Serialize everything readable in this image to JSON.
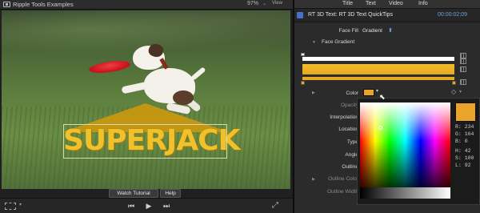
{
  "viewer": {
    "title": "Ripple Tools Examples",
    "zoom": "97%",
    "zoom_caret": "⌄",
    "view_menu": "View",
    "overlay_text": "SUPERJACK",
    "watch_tutorial": "Watch Tutorial",
    "help": "Help",
    "transport": {
      "prev": "⏮",
      "play": "▶",
      "next": "⏭"
    },
    "fullscreen": "⤢",
    "fit_caret": "▾"
  },
  "inspector": {
    "tabs": [
      "Title",
      "Text",
      "Video",
      "Info"
    ],
    "generator_title": "RT 3D Text: RT 3D Text QuickTips",
    "timecode": "00:00:02;09",
    "face_fill_label": "Face Fill",
    "face_fill_value": "Gradient",
    "face_fill_caret": "⬍",
    "face_gradient_label": "Face Gradient",
    "color_label": "Color",
    "opacity_label": "Opacity",
    "interpolation_label": "Interpolation",
    "location_label": "Location",
    "type_label": "Type",
    "angle_label": "Angle",
    "outline_label": "Outline",
    "outline_color_label": "Outline Color",
    "outline_width_label": "Outline Width",
    "swatch_caret": "▾",
    "keyframe_icon": "◇",
    "keyframe_caret": "▾",
    "disclosure_closed": "▶",
    "disclosure_open": "▼",
    "cursor_glyph": "⬉"
  },
  "picker": {
    "r": "R:  234",
    "g": "G:  164",
    "b": "B:    0",
    "h": "H:   42",
    "s": "S:  100",
    "l": "L:   92"
  },
  "colors": {
    "text_fill": "#f0c12a",
    "gradient": "#e8a822",
    "swatch": "#eaa42c",
    "accent_blue": "#6fa0e0"
  }
}
